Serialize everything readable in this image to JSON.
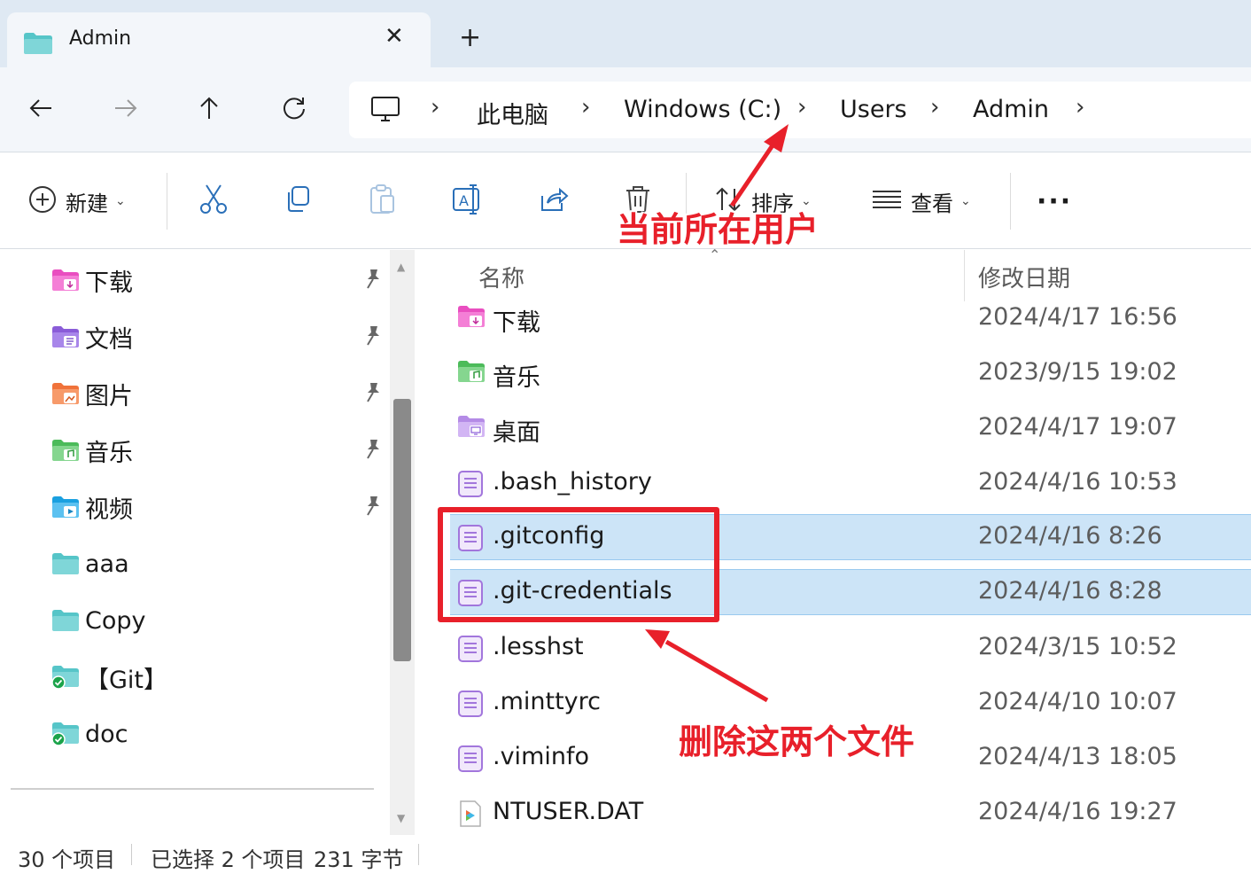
{
  "tab": {
    "title": "Admin",
    "close_icon": "close-icon",
    "new_tab_icon": "plus-icon"
  },
  "nav": {
    "breadcrumb": [
      "此电脑",
      "Windows (C:)",
      "Users",
      "Admin"
    ],
    "icons": [
      "back-arrow-icon",
      "forward-arrow-icon",
      "up-arrow-icon",
      "refresh-icon",
      "computer-icon"
    ]
  },
  "toolbar": {
    "new_label": "新建",
    "sort_label": "排序",
    "view_label": "查看",
    "more_label": "···"
  },
  "sidebar": {
    "items": [
      {
        "label": "下载",
        "pinned": true,
        "color": "#e94ec0"
      },
      {
        "label": "文档",
        "pinned": true,
        "color": "#8a5cd8"
      },
      {
        "label": "图片",
        "pinned": true,
        "color": "#f0723a"
      },
      {
        "label": "音乐",
        "pinned": true,
        "color": "#4cbb5a"
      },
      {
        "label": "视频",
        "pinned": true,
        "color": "#1aa0e0"
      },
      {
        "label": "aaa",
        "pinned": false,
        "color": "#5ec7c7"
      },
      {
        "label": "Copy",
        "pinned": false,
        "color": "#5ec7c7"
      },
      {
        "label": "【Git】",
        "pinned": false,
        "color": "#5ec7c7"
      },
      {
        "label": "doc",
        "pinned": false,
        "color": "#5ec7c7"
      }
    ]
  },
  "filelist": {
    "columns": {
      "name": "名称",
      "modified": "修改日期"
    },
    "rows": [
      {
        "name": "下载",
        "date": "2024/4/17 16:56",
        "type": "folder-download",
        "selected": false
      },
      {
        "name": "音乐",
        "date": "2023/9/15 19:02",
        "type": "folder-music",
        "selected": false
      },
      {
        "name": "桌面",
        "date": "2024/4/17 19:07",
        "type": "folder-desktop",
        "selected": false
      },
      {
        "name": ".bash_history",
        "date": "2024/4/16 10:53",
        "type": "text-file",
        "selected": false
      },
      {
        "name": ".gitconfig",
        "date": "2024/4/16 8:26",
        "type": "text-file",
        "selected": true
      },
      {
        "name": ".git-credentials",
        "date": "2024/4/16 8:28",
        "type": "text-file",
        "selected": true
      },
      {
        "name": ".lesshst",
        "date": "2024/3/15 10:52",
        "type": "text-file",
        "selected": false
      },
      {
        "name": ".minttyrc",
        "date": "2024/4/10 10:07",
        "type": "text-file",
        "selected": false
      },
      {
        "name": ".viminfo",
        "date": "2024/4/13 18:05",
        "type": "text-file",
        "selected": false
      },
      {
        "name": "NTUSER.DAT",
        "date": "2024/4/16 19:27",
        "type": "media-file",
        "selected": false
      }
    ]
  },
  "status": {
    "count": "30 个项目",
    "selection": "已选择 2 个项目",
    "size": "231 字节"
  },
  "annotations": {
    "current_user": "当前所在用户",
    "delete_files": "删除这两个文件",
    "color": "#e8202a"
  }
}
